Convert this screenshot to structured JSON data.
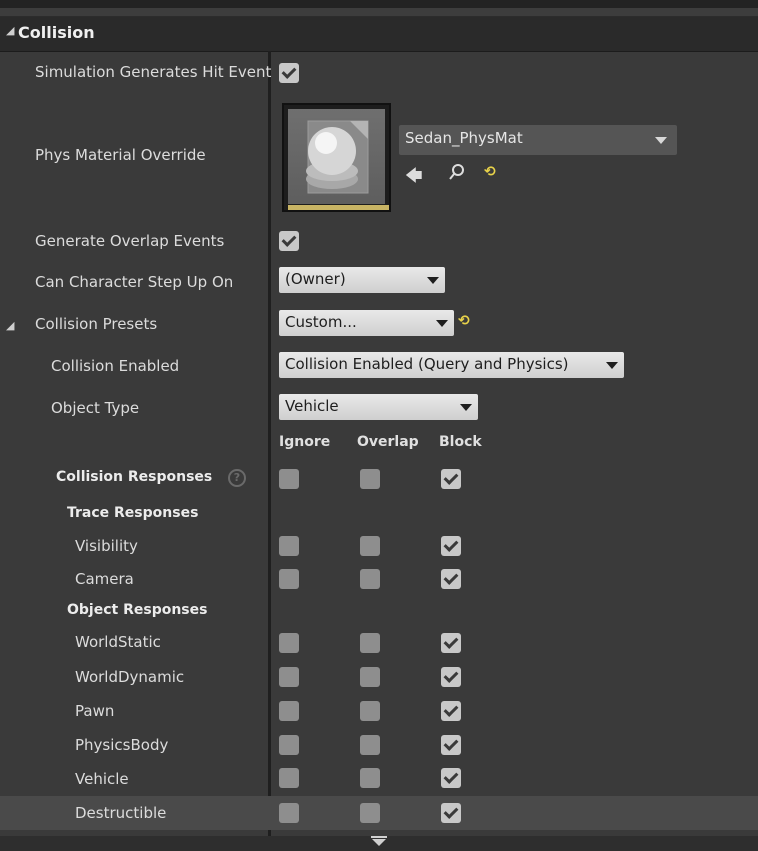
{
  "section": {
    "title": "Collision"
  },
  "rows": {
    "sim_hit": "Simulation Generates Hit Events",
    "phys_material": "Phys Material Override",
    "gen_overlap": "Generate Overlap Events",
    "can_step": "Can Character Step Up On",
    "presets": "Collision Presets",
    "collision_enabled": "Collision Enabled",
    "object_type": "Object Type"
  },
  "phys_asset": {
    "name": "Sedan_PhysMat"
  },
  "combos": {
    "can_step": "(Owner)",
    "presets": "Custom...",
    "collision_enabled": "Collision Enabled (Query and Physics)",
    "object_type": "Vehicle"
  },
  "response_headers": [
    "Ignore",
    "Overlap",
    "Block"
  ],
  "collision_responses": {
    "label": "Collision Responses"
  },
  "trace_responses": {
    "label": "Trace Responses",
    "items": [
      "Visibility",
      "Camera"
    ]
  },
  "object_responses": {
    "label": "Object Responses",
    "items": [
      "WorldStatic",
      "WorldDynamic",
      "Pawn",
      "PhysicsBody",
      "Vehicle",
      "Destructible"
    ]
  },
  "icons": {
    "section_expand": "triangle-down-icon",
    "use_selected": "arrow-left-icon",
    "browse": "search-icon",
    "reset": "reset-to-default-icon",
    "help": "help-icon",
    "dropdown": "chevron-down-icon"
  },
  "colors": {
    "reset_icon": "#e8d24a",
    "thumbnail_bar": "#c8b464"
  }
}
